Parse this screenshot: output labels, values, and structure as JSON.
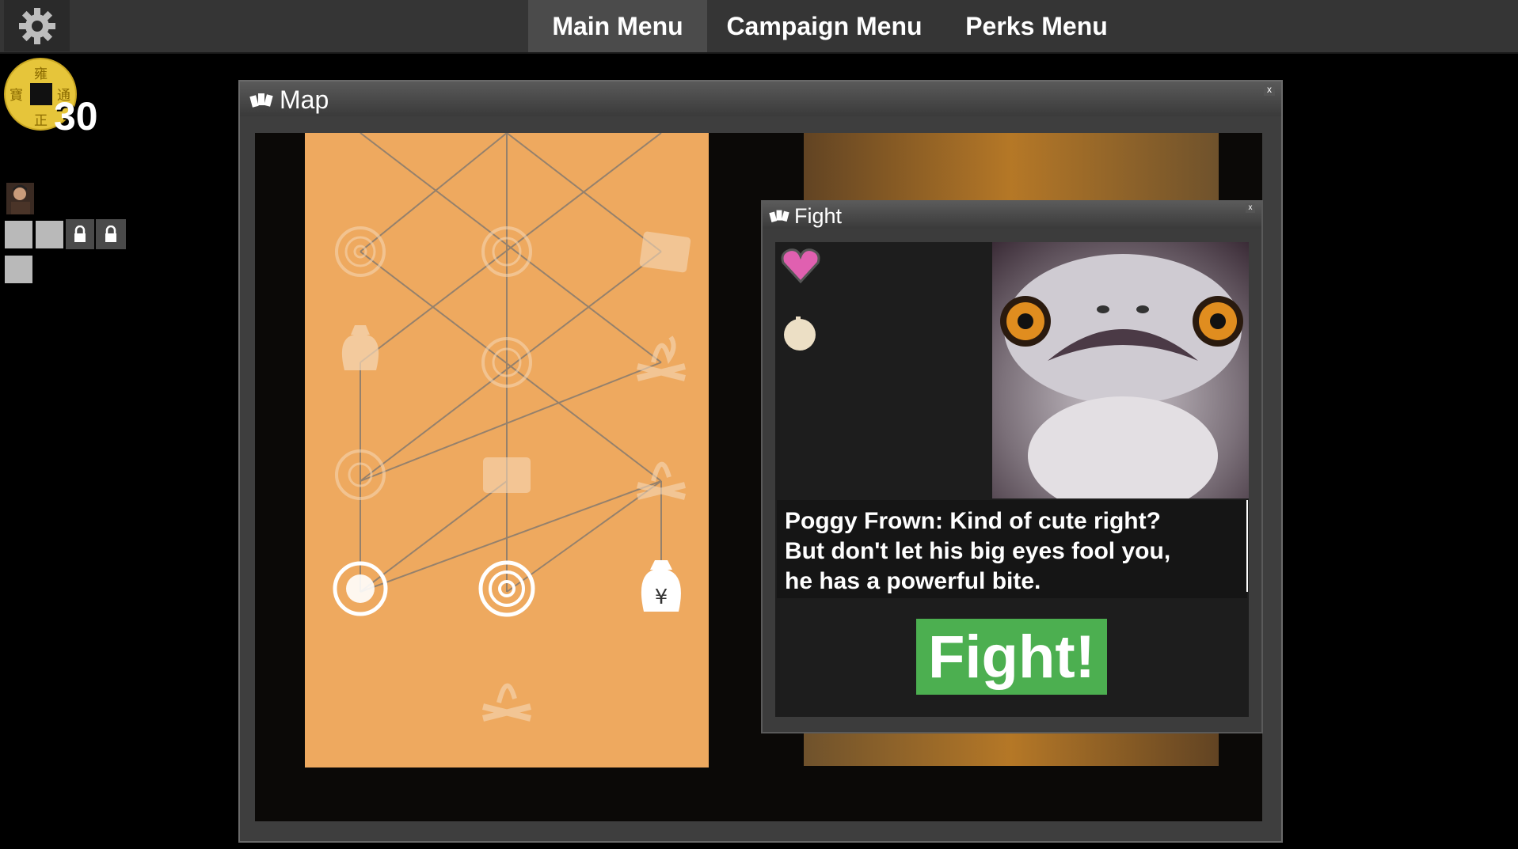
{
  "topbar": {
    "settings_icon": "gear-icon",
    "tabs": [
      {
        "label": "Main Menu",
        "active": true
      },
      {
        "label": "Campaign Menu",
        "active": false
      },
      {
        "label": "Perks Menu",
        "active": false
      }
    ]
  },
  "hud": {
    "coin_count": "30",
    "coin_characters": [
      "雍",
      "正",
      "通",
      "寶"
    ],
    "slot_icons": [
      "lock-icon",
      "lock-icon"
    ]
  },
  "map_window": {
    "title": "Map",
    "close_label": "x",
    "node_icons": [
      "spiral-node",
      "fire-node",
      "money-bag-node",
      "tile-node",
      "whirl-node"
    ],
    "paper_color": "#eea95f"
  },
  "fight_window": {
    "title": "Fight",
    "close_label": "x",
    "dialog_lines": [
      "Poggy Frown: Kind of cute right?",
      "But don't let his big eyes fool you,",
      "he has a powerful bite."
    ],
    "fight_button": "Fight!",
    "fight_button_color": "#4caf50"
  }
}
